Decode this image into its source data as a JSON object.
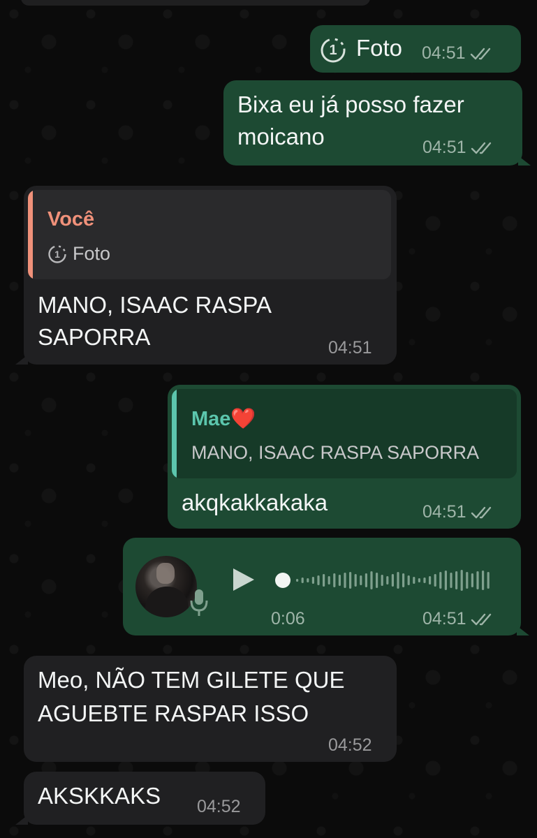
{
  "messages": {
    "m1": {
      "icon": "view-once-icon",
      "once_glyph": "1",
      "text": "Foto",
      "time": "04:51"
    },
    "m2": {
      "line1": "Bixa eu já posso fazer",
      "line2": "moicano",
      "time": "04:51"
    },
    "m3": {
      "quote_author": "Você",
      "quote_once_glyph": "1",
      "quote_text": "Foto",
      "line1": "MANO, ISAAC RASPA",
      "line2": "SAPORRA",
      "time": "04:51"
    },
    "m4": {
      "quote_author": "Mae",
      "quote_heart": "❤️",
      "quote_text": "MANO, ISAAC RASPA SAPORRA",
      "text": "akqkakkakaka",
      "time": "04:51"
    },
    "m5": {
      "duration": "0:06",
      "time": "04:51"
    },
    "m6": {
      "line1": "Meo, NÃO TEM GILETE QUE",
      "line2": "AGUEBTE RASPAR ISSO",
      "time": "04:52"
    },
    "m7": {
      "text": "AKSKKAKS",
      "time": "04:52"
    }
  },
  "colors": {
    "outgoing_bubble": "#1d4a33",
    "incoming_bubble": "#202022",
    "quote_you": "#f0917a",
    "quote_mae": "#5cc6ad"
  }
}
